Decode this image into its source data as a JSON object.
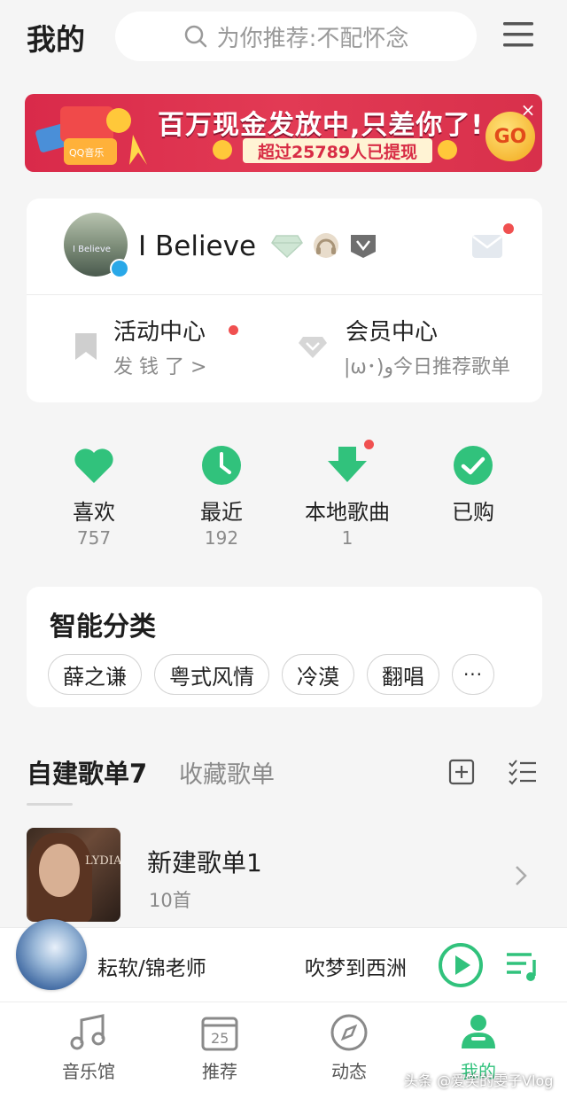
{
  "header": {
    "title": "我的",
    "search_placeholder": "为你推荐:不配怀念"
  },
  "banner": {
    "main_text": "百万现金发放中,只差你了!",
    "sub_text": "超过25789人已提现",
    "go_label": "GO",
    "close_label": "×",
    "gift_label": "QQ音乐"
  },
  "profile": {
    "avatar_text": "I Believe",
    "username": "I   Believe",
    "entries": [
      {
        "label": "活动中心",
        "desc": "发 钱 了 >"
      },
      {
        "label": "会员中心",
        "desc": "|ω･)و今日推荐歌单"
      }
    ]
  },
  "quick_access": [
    {
      "label": "喜欢",
      "count": "757",
      "icon": "heart-icon"
    },
    {
      "label": "最近",
      "count": "192",
      "icon": "clock-icon"
    },
    {
      "label": "本地歌曲",
      "count": "1",
      "icon": "download-icon"
    },
    {
      "label": "已购",
      "count": "",
      "icon": "check-icon"
    }
  ],
  "smart_category": {
    "title": "智能分类",
    "tags": [
      "薛之谦",
      "粤式风情",
      "冷漠",
      "翻唱",
      "···"
    ]
  },
  "playlists": {
    "tab_created": "自建歌单7",
    "tab_collected": "收藏歌单",
    "items": [
      {
        "name": "新建歌单1",
        "count": "10首",
        "cover_text": "LYDIA"
      }
    ]
  },
  "player": {
    "artist": "耘软/锦老师",
    "song": "吹梦到西洲"
  },
  "tabbar": {
    "tabs": [
      {
        "label": "音乐馆",
        "icon": "music-note-icon"
      },
      {
        "label": "推荐",
        "icon": "calendar-icon",
        "icon_text": "25"
      },
      {
        "label": "动态",
        "icon": "compass-icon"
      },
      {
        "label": "我的",
        "icon": "person-icon"
      }
    ]
  },
  "watermark": "头条 @爱笑的雯子Vlog",
  "colors": {
    "accent": "#31c27c",
    "notification": "#f05050",
    "banner": "#e23a54"
  }
}
